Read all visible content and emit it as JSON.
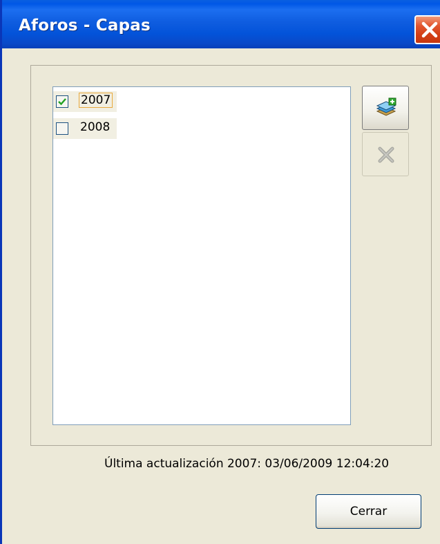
{
  "window": {
    "title": "Aforos - Capas"
  },
  "layers": {
    "items": [
      {
        "label": "2007",
        "checked": true,
        "focused": true
      },
      {
        "label": "2008",
        "checked": false,
        "focused": false
      }
    ]
  },
  "toolbar": {
    "add_icon": "add-layer-icon",
    "delete_icon": "delete-layer-icon",
    "delete_enabled": false
  },
  "status": {
    "last_update": "Última actualización 2007: 03/06/2009 12:04:20"
  },
  "footer": {
    "close_label": "Cerrar"
  },
  "colors": {
    "titlebar": "#0058E6",
    "background": "#ECE9D8",
    "close_red": "#D23E15",
    "check_green": "#21A121"
  }
}
